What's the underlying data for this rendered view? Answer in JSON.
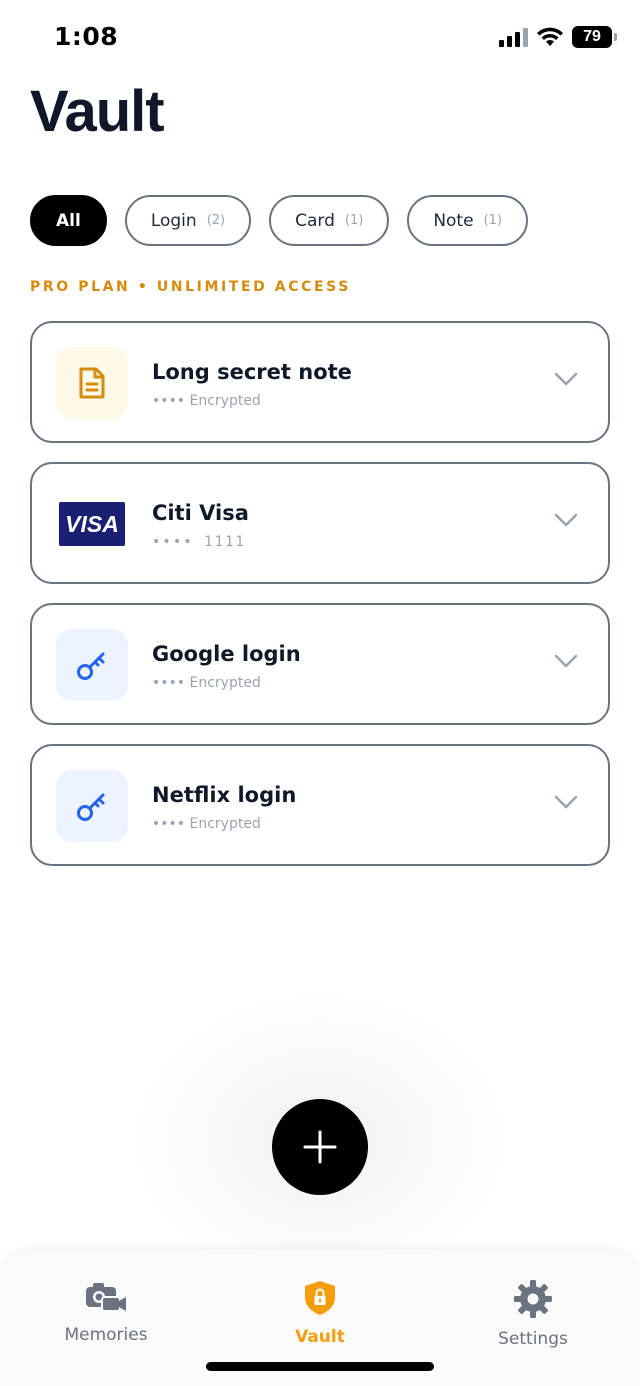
{
  "status": {
    "time": "1:08",
    "battery": "79",
    "battery_level": 0.79
  },
  "title": "Vault",
  "filters": [
    {
      "label": "All",
      "count": ""
    },
    {
      "label": "Login",
      "count": "(2)"
    },
    {
      "label": "Card",
      "count": "(1)"
    },
    {
      "label": "Note",
      "count": "(1)"
    }
  ],
  "plan_banner": "PRO PLAN • UNLIMITED ACCESS",
  "items": [
    {
      "title": "Long secret note",
      "subtitle": "•••• Encrypted",
      "icon": "note-icon"
    },
    {
      "title": "Citi Visa",
      "subtitle": "•••• 1111",
      "icon": "visa-logo",
      "brand": "VISA"
    },
    {
      "title": "Google login",
      "subtitle": "•••• Encrypted",
      "icon": "key-icon"
    },
    {
      "title": "Netflix login",
      "subtitle": "•••• Encrypted",
      "icon": "key-icon"
    }
  ],
  "tabs": [
    {
      "label": "Memories",
      "icon": "camera-icon",
      "active": false
    },
    {
      "label": "Vault",
      "icon": "shield-lock-icon",
      "active": true
    },
    {
      "label": "Settings",
      "icon": "gear-icon",
      "active": false
    }
  ],
  "colors": {
    "accent": "#f59e0b",
    "plan": "#d58b0d",
    "key": "#2563eb",
    "note": "#d58b0d",
    "visa": "#1a1f71"
  }
}
